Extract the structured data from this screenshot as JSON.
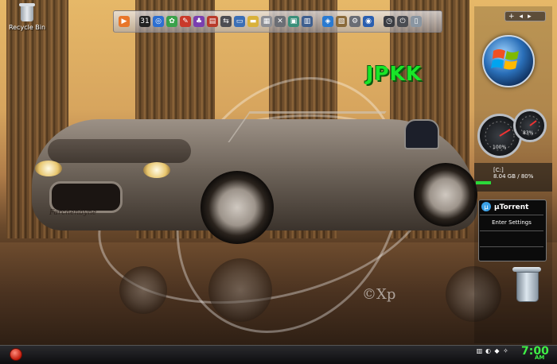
{
  "desktop": {
    "icons": [
      {
        "label": "Recycle Bin",
        "icon": "recycle-bin-icon"
      }
    ],
    "logo_text": "JPKK",
    "watermark_text": "©Xp",
    "car_signature": "Farchenbyne"
  },
  "dock": {
    "items": [
      {
        "icon": "media-player-icon",
        "color": "#e8762a",
        "glyph": "▶"
      },
      {
        "icon": "calendar-icon",
        "color": "#222222",
        "glyph": "31"
      },
      {
        "icon": "safari-icon",
        "color": "#2d6fd1",
        "glyph": "◎"
      },
      {
        "icon": "photos-icon",
        "color": "#3aa14a",
        "glyph": "✿"
      },
      {
        "icon": "paint-icon",
        "color": "#c9392a",
        "glyph": "✎"
      },
      {
        "icon": "game-icon",
        "color": "#7a3fb0",
        "glyph": "♣"
      },
      {
        "icon": "books-icon",
        "color": "#b83a2a",
        "glyph": "▤"
      },
      {
        "icon": "network-icon",
        "color": "#4d4d52",
        "glyph": "⇆"
      },
      {
        "icon": "computer-icon",
        "color": "#3b6fb6",
        "glyph": "▭"
      },
      {
        "icon": "folder-icon",
        "color": "#d9b13a",
        "glyph": "▬"
      },
      {
        "icon": "document-icon",
        "color": "#8d8f95",
        "glyph": "▦"
      },
      {
        "icon": "tools-icon",
        "color": "#6b6e75",
        "glyph": "✕"
      },
      {
        "icon": "image-icon",
        "color": "#3a8f7a",
        "glyph": "▣"
      },
      {
        "icon": "monitor-icon",
        "color": "#3f5f8f",
        "glyph": "▥"
      },
      {
        "icon": "windows-icon",
        "color": "#2a7ad1",
        "glyph": "◈"
      },
      {
        "icon": "archive-icon",
        "color": "#8a6a3a",
        "glyph": "▧"
      },
      {
        "icon": "settings-icon",
        "color": "#6a6d74",
        "glyph": "⚙"
      },
      {
        "icon": "explorer-icon",
        "color": "#2a5fb0",
        "glyph": "◉"
      },
      {
        "icon": "clock-icon",
        "color": "#3a3c42",
        "glyph": "◷"
      },
      {
        "icon": "power-icon",
        "color": "#4a4c52",
        "glyph": "⏻"
      },
      {
        "icon": "trash-icon",
        "color": "#8a96a2",
        "glyph": "▯"
      }
    ]
  },
  "sidebar": {
    "add_glyph": "+",
    "prev_glyph": "◂",
    "next_glyph": "▸",
    "gauge_cpu_label": "100%",
    "gauge_mem_label": "83%",
    "drive": {
      "letter": "[C:]",
      "usage": "8.04 GB / 80%",
      "percent": 80
    },
    "utorrent": {
      "title": "µTorrent",
      "button": "Enter Settings"
    }
  },
  "taskbar": {
    "time": "7:00",
    "ampm": "AM",
    "tray_icons": [
      {
        "icon": "network-tray-icon",
        "glyph": "▥"
      },
      {
        "icon": "volume-tray-icon",
        "glyph": "◐"
      },
      {
        "icon": "security-tray-icon",
        "glyph": "◆"
      },
      {
        "icon": "tool-tray-icon",
        "glyph": "✧"
      }
    ]
  }
}
